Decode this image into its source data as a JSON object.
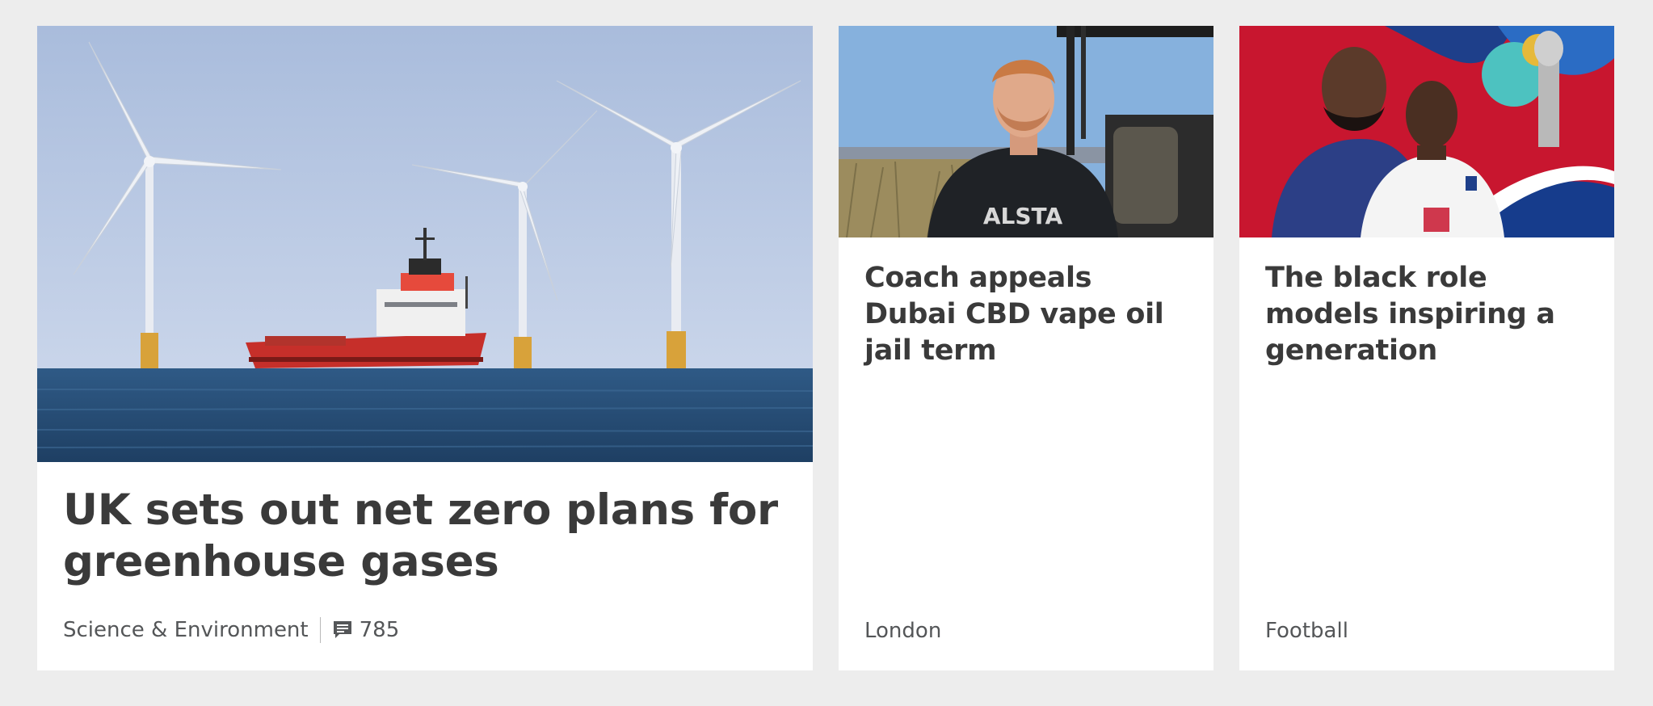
{
  "stories": [
    {
      "headline": "UK sets out net zero plans for greenhouse gases",
      "section": "Science & Environment",
      "comments": "785"
    },
    {
      "headline": "Coach appeals Dubai CBD vape oil jail term",
      "section": "London"
    },
    {
      "headline": "The black role models inspiring a generation",
      "section": "Football"
    }
  ],
  "icons": {
    "comments": "speech-bubble-icon"
  },
  "colors": {
    "page_bg": "#ededed",
    "card_bg": "#ffffff",
    "headline": "#3a3a3a",
    "meta": "#545658"
  }
}
